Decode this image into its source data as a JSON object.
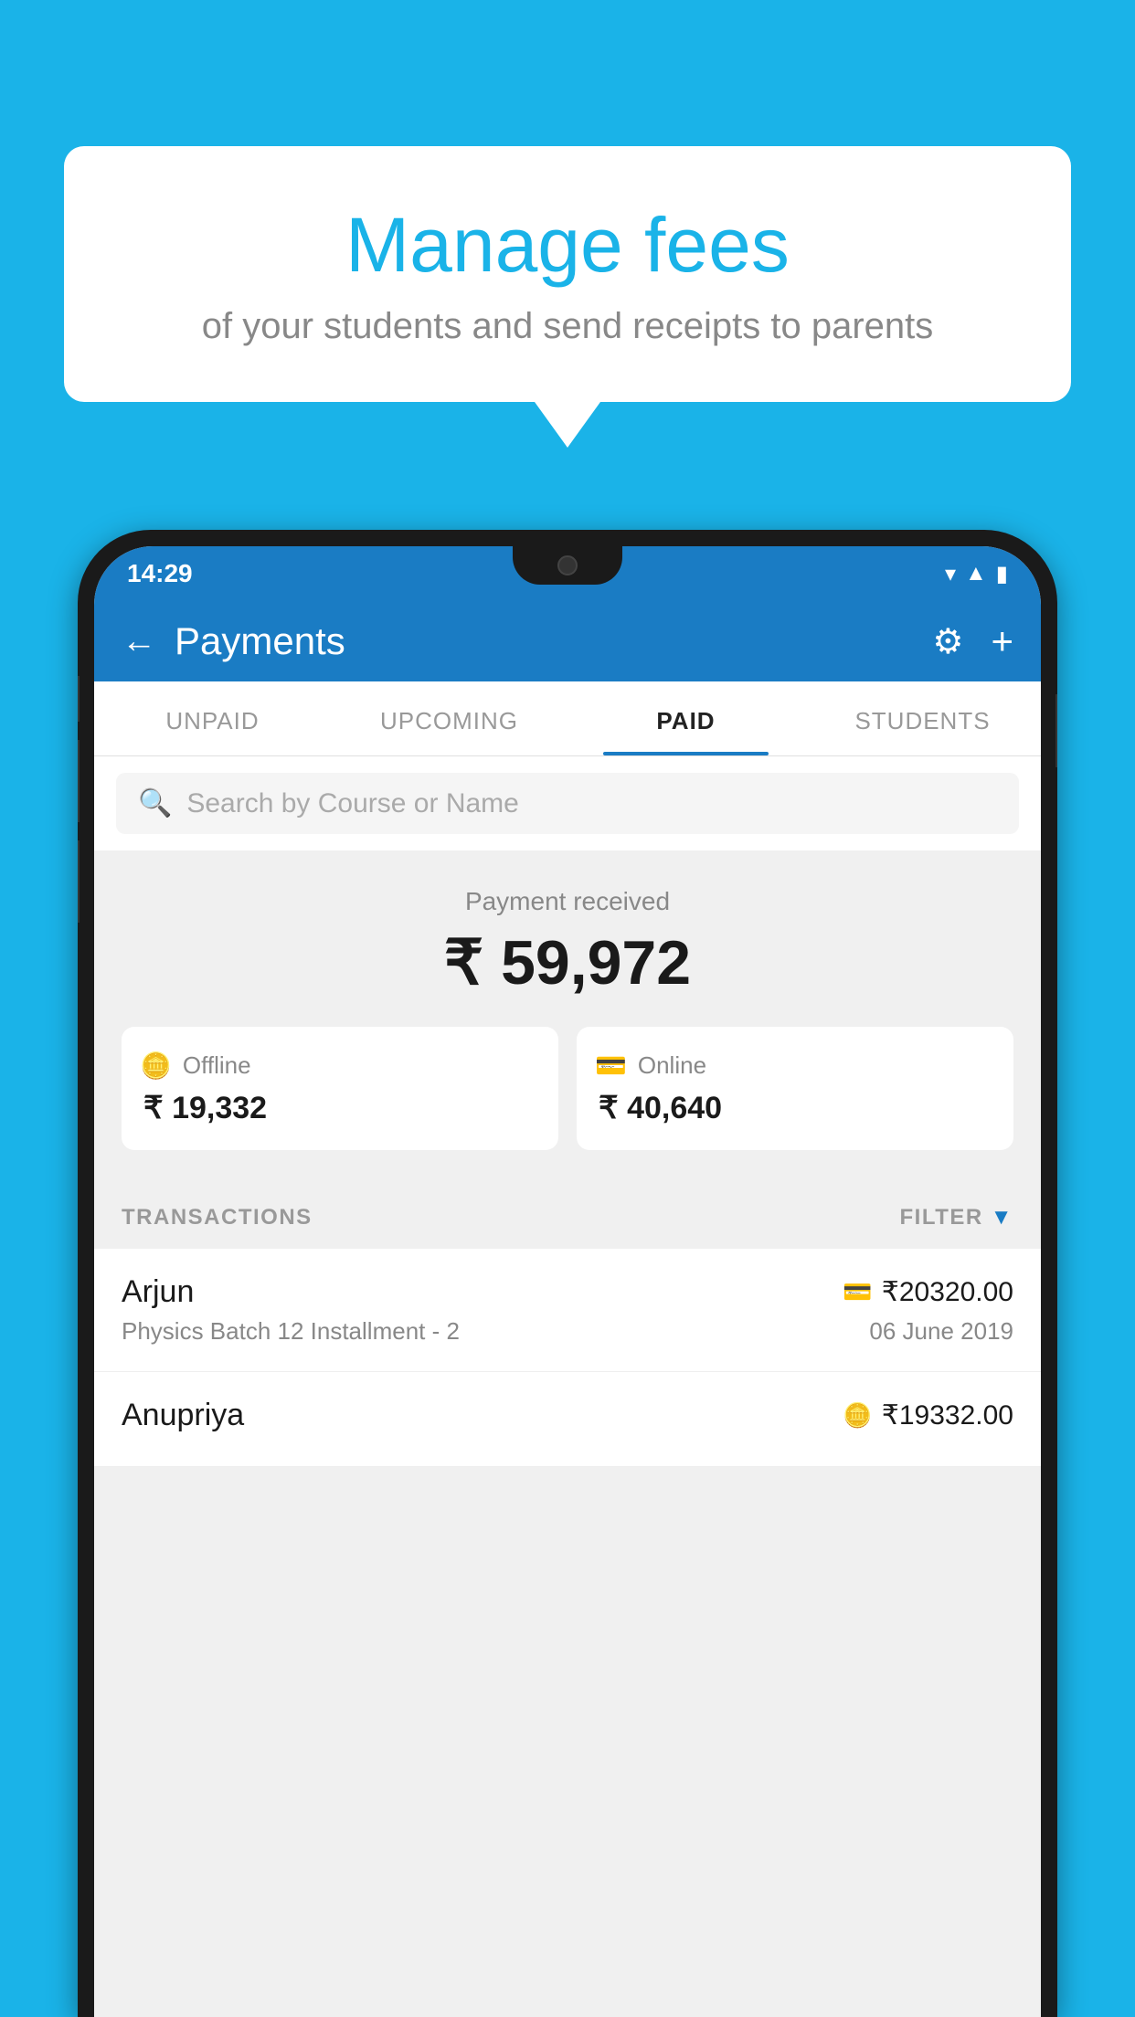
{
  "bubble": {
    "title": "Manage fees",
    "subtitle": "of your students and send receipts to parents"
  },
  "status_bar": {
    "time": "14:29"
  },
  "header": {
    "title": "Payments",
    "back_label": "←",
    "settings_label": "⚙",
    "add_label": "+"
  },
  "tabs": [
    {
      "label": "UNPAID",
      "active": false
    },
    {
      "label": "UPCOMING",
      "active": false
    },
    {
      "label": "PAID",
      "active": true
    },
    {
      "label": "STUDENTS",
      "active": false
    }
  ],
  "search": {
    "placeholder": "Search by Course or Name"
  },
  "payment_summary": {
    "label": "Payment received",
    "total": "₹ 59,972",
    "offline_label": "Offline",
    "offline_amount": "₹ 19,332",
    "online_label": "Online",
    "online_amount": "₹ 40,640"
  },
  "transactions": {
    "header_label": "TRANSACTIONS",
    "filter_label": "FILTER",
    "items": [
      {
        "name": "Arjun",
        "amount": "₹20320.00",
        "course": "Physics Batch 12 Installment - 2",
        "date": "06 June 2019",
        "payment_type": "online"
      },
      {
        "name": "Anupriya",
        "amount": "₹19332.00",
        "course": "",
        "date": "",
        "payment_type": "offline"
      }
    ]
  }
}
